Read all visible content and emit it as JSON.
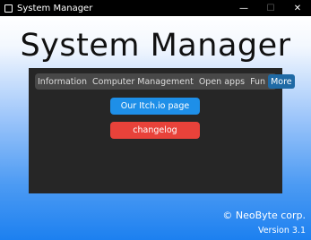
{
  "window": {
    "title": "System Manager",
    "minimize_glyph": "—",
    "maximize_glyph": "☐",
    "close_glyph": "✕"
  },
  "header": {
    "title": "System Manager"
  },
  "tabs": [
    {
      "label": "Information",
      "active": false
    },
    {
      "label": "Computer Management",
      "active": false
    },
    {
      "label": "Open apps",
      "active": false
    },
    {
      "label": "Fun",
      "active": false
    },
    {
      "label": "More",
      "active": true
    }
  ],
  "buttons": {
    "itch_label": "Our Itch.io page",
    "changelog_label": "changelog"
  },
  "footer": {
    "credit": "© NeoByte corp.",
    "version": "Version 3.1"
  },
  "colors": {
    "active_tab": "#1f6aa5",
    "itch_button": "#1e8fe8",
    "changelog_button": "#e8423a",
    "panel": "#262626"
  }
}
